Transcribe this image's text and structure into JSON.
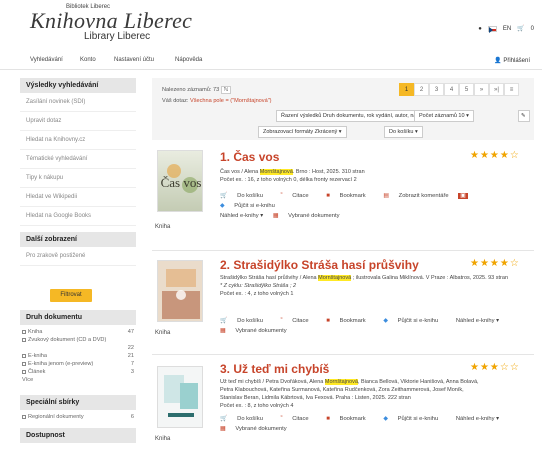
{
  "header": {
    "library_small": "Bibliotek Liberec",
    "logo": "Knihovna Liberec",
    "logo_sub": "Library Liberec",
    "lang": "EN",
    "cart_count": "0"
  },
  "nav": {
    "items": [
      "Vyhledávání",
      "Konto",
      "Nastavení účtu",
      "Nápověda"
    ],
    "login": "Přihlášení"
  },
  "sidebar": {
    "results_title": "Výsledky vyhledávání",
    "links": [
      "Zasílání novinek (SDI)",
      "Upravit dotaz",
      "Hledat na Knihovny.cz",
      "Tématické vyhledávání",
      "Tipy k nákupu",
      "Hledat ve Wikipedii",
      "Hledat na Google Books"
    ],
    "more_title": "Další zobrazení",
    "more_links": [
      "Pro zrakově postižené"
    ],
    "filter_btn": "Filtrovat",
    "doc_type_title": "Druh dokumentu",
    "doc_types": [
      {
        "label": "Kniha",
        "count": "47"
      },
      {
        "label": "Zvukový dokument (CD a DVD)",
        "count": "22"
      },
      {
        "label": "E-kniha",
        "count": "21"
      },
      {
        "label": "E-kniha jenom (e-preview)",
        "count": "7"
      },
      {
        "label": "Článek",
        "count": "3"
      }
    ],
    "more": "Více",
    "special_title": "Speciální sbírky",
    "special": [
      {
        "label": "Regionální dokumenty",
        "count": "6"
      }
    ],
    "avail_title": "Dostupnost"
  },
  "results": {
    "count_text": "Nalezeno záznamů: 73",
    "query_label": "Váš dotaz:",
    "query_text": "Všechna pole = (\"Mornštajnová\")",
    "pages": [
      "1",
      "2",
      "3",
      "4",
      "5",
      "»",
      "»|",
      "≡"
    ],
    "sort": "Řazení výsledků Druh dokumentu, rok vydání, autor, název ▾",
    "per_page": "Počet záznamů 10 ▾",
    "view": "Zobrazovací formáty Zkrácený ▾",
    "cart": "Do košíku ▾",
    "records": [
      {
        "title": "1. Čas vos",
        "stars": "★★★★☆",
        "meta1_pre": "Čas vos / Alena ",
        "meta1_hl": "Mornštajnová",
        "meta1_post": ". Brno : Host, 2025. 310 stran",
        "meta2": "Počet ex. : 16, z toho volných 0, délka fronty rezervací 2",
        "actions1": [
          "Do košíku",
          "Citace",
          "Bookmark",
          "Zobrazit komentáře",
          "Půjčit si e-knihu"
        ],
        "actions2": [
          "Náhled e-knihy ▾",
          "Vybrané dokumenty"
        ],
        "kind": "Kniha",
        "cover_title": "Čas vos"
      },
      {
        "title": "2. Strašidýlko Stráša hasí průšvihy",
        "stars": "★★★★☆",
        "meta1_pre": "Strašidýlko Stráša hasí průšvihy / Alena ",
        "meta1_hl": "Mornštajnová",
        "meta1_post": " ; ilustrovala Galina Miklínová. V Praze : Albatros, 2025. 93 stran",
        "meta_series": "* Z cyklu: Strašidýlko Stráša ; 2",
        "meta2": "Počet ex. : 4, z toho volných 1",
        "actions1": [
          "Do košíku",
          "Citace",
          "Bookmark",
          "Půjčit si e-knihu",
          "Náhled e-knihy ▾"
        ],
        "actions2": [
          "Vybrané dokumenty"
        ],
        "kind": "Kniha"
      },
      {
        "title": "3. Už teď mi chybíš",
        "stars": "★★★☆☆",
        "meta1_pre": "Už teď mi chybíš / Petra Dvořáková, Alena ",
        "meta1_hl": "Mornštajnová",
        "meta1_post": ", Bianca Bellová, Viktorie Hanišová, Anna Bolavá,",
        "meta1b": "Petra Klabouchová, Kateřina Surmanová, Kateřina Rudčenková, Zora Zeithammerová, Josef Moník,",
        "meta1c": "Stanislav Beran, Lidmila Kábrtová, Iva Fexová. Praha : Listen, 2025. 222 stran",
        "meta2": "Počet ex. : 8, z toho volných 4",
        "actions1": [
          "Do košíku",
          "Citace",
          "Bookmark",
          "Půjčit si e-knihu",
          "Náhled e-knihy ▾"
        ],
        "actions2": [
          "Vybrané dokumenty"
        ],
        "kind": "Kniha"
      }
    ]
  }
}
